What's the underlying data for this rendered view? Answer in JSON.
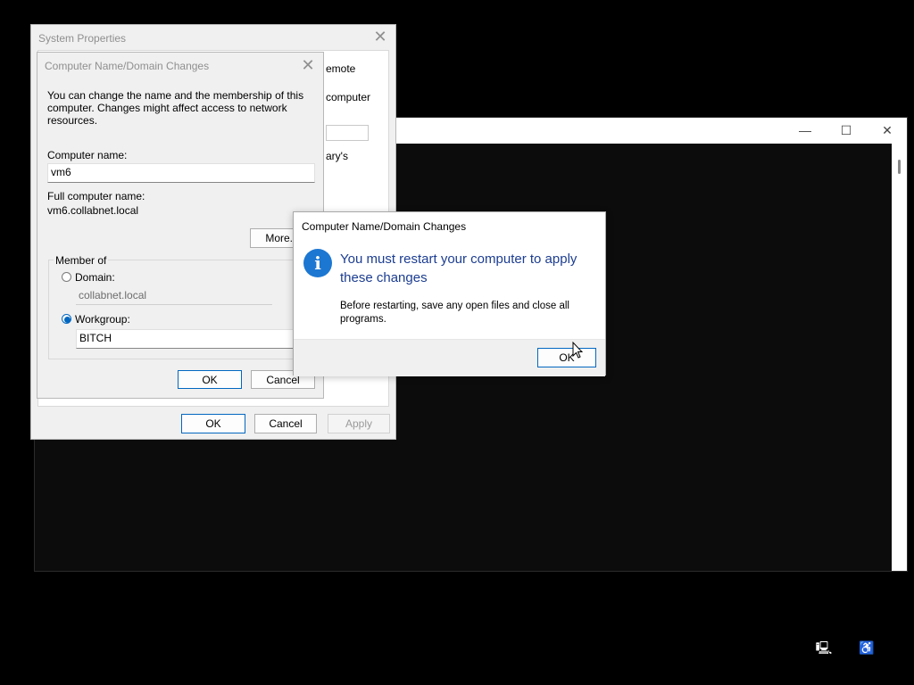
{
  "console_window": {
    "minimize": "—",
    "maximize": "☐",
    "close": "✕"
  },
  "system_properties": {
    "title": "System Properties",
    "close": "✕",
    "partial_texts": [
      "emote",
      "computer",
      "ary's"
    ],
    "ok_label": "OK",
    "cancel_label": "Cancel",
    "apply_label": "Apply"
  },
  "domain_changes": {
    "title": "Computer Name/Domain Changes",
    "close": "✕",
    "intro": "You can change the name and the membership of this computer. Changes might affect access to network resources.",
    "computer_name_label": "Computer name:",
    "computer_name_value": "vm6",
    "full_name_label": "Full computer name:",
    "full_name_value": "vm6.collabnet.local",
    "more_label": "More...",
    "member_of_label": "Member of",
    "domain_label": "Domain:",
    "domain_value": "collabnet.local",
    "workgroup_label": "Workgroup:",
    "workgroup_value": "BITCH",
    "ok_label": "OK",
    "cancel_label": "Cancel"
  },
  "restart_dialog": {
    "title": "Computer Name/Domain Changes",
    "icon": "i",
    "main_message": "You must restart your computer to apply these changes",
    "sub_message": "Before restarting, save any open files and close all programs.",
    "ok_label": "OK"
  },
  "tray": {
    "network_icon": "🖳",
    "accessibility_icon": "♿"
  }
}
